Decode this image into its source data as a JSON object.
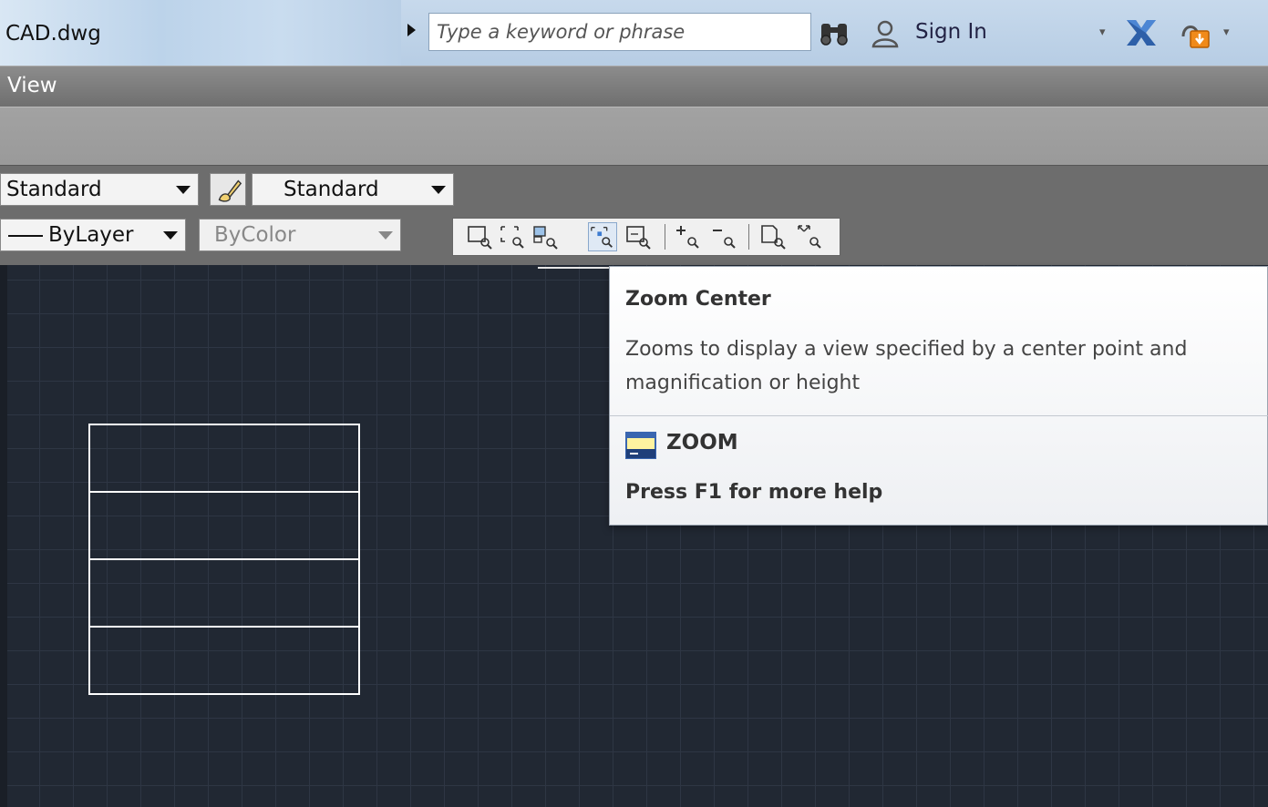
{
  "titlebar": {
    "file_title": "CAD.dwg",
    "search_placeholder": "Type a keyword or phrase",
    "sign_in_label": "Sign In",
    "icons": [
      "binoculars-icon",
      "user-icon",
      "x-exchange-icon",
      "lock-download-icon"
    ]
  },
  "menubar": {
    "view_label": "View"
  },
  "toolbar": {
    "text_style": "Standard",
    "dim_style": "Standard",
    "linetype": "ByLayer",
    "plot_style": "ByColor",
    "zoom_buttons": [
      "zoom-window-icon",
      "zoom-dynamic-icon",
      "zoom-scale-icon",
      "zoom-center-icon",
      "zoom-object-icon",
      "zoom-in-icon",
      "zoom-out-icon",
      "zoom-all-icon",
      "zoom-extents-icon"
    ],
    "active_zoom_button": "zoom-center-icon"
  },
  "colors": {
    "canvas_bg": "#212833",
    "grid": "#2e3644",
    "drawing_lines": "#ffffff",
    "menubar": "#7a7a7a"
  },
  "tooltip": {
    "title": "Zoom Center",
    "description": "Zooms to display a view specified by a center point and magnification or height",
    "command": "ZOOM",
    "help": "Press F1 for more help"
  }
}
